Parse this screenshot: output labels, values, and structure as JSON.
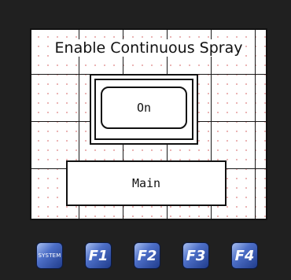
{
  "screen": {
    "title": "Enable Continuous Spray",
    "on_button_label": "On",
    "main_button_label": "Main"
  },
  "function_keys": [
    {
      "label": "SYSTEM"
    },
    {
      "label": "F1"
    },
    {
      "label": "F2"
    },
    {
      "label": "F3"
    },
    {
      "label": "F4"
    }
  ],
  "colors": {
    "bezel": "#202020",
    "screen_bg": "#ffffff",
    "grid_line": "#1a1a1a",
    "grid_dot": "#e7a5a5",
    "fkey_blue": "#4d6fc8"
  }
}
